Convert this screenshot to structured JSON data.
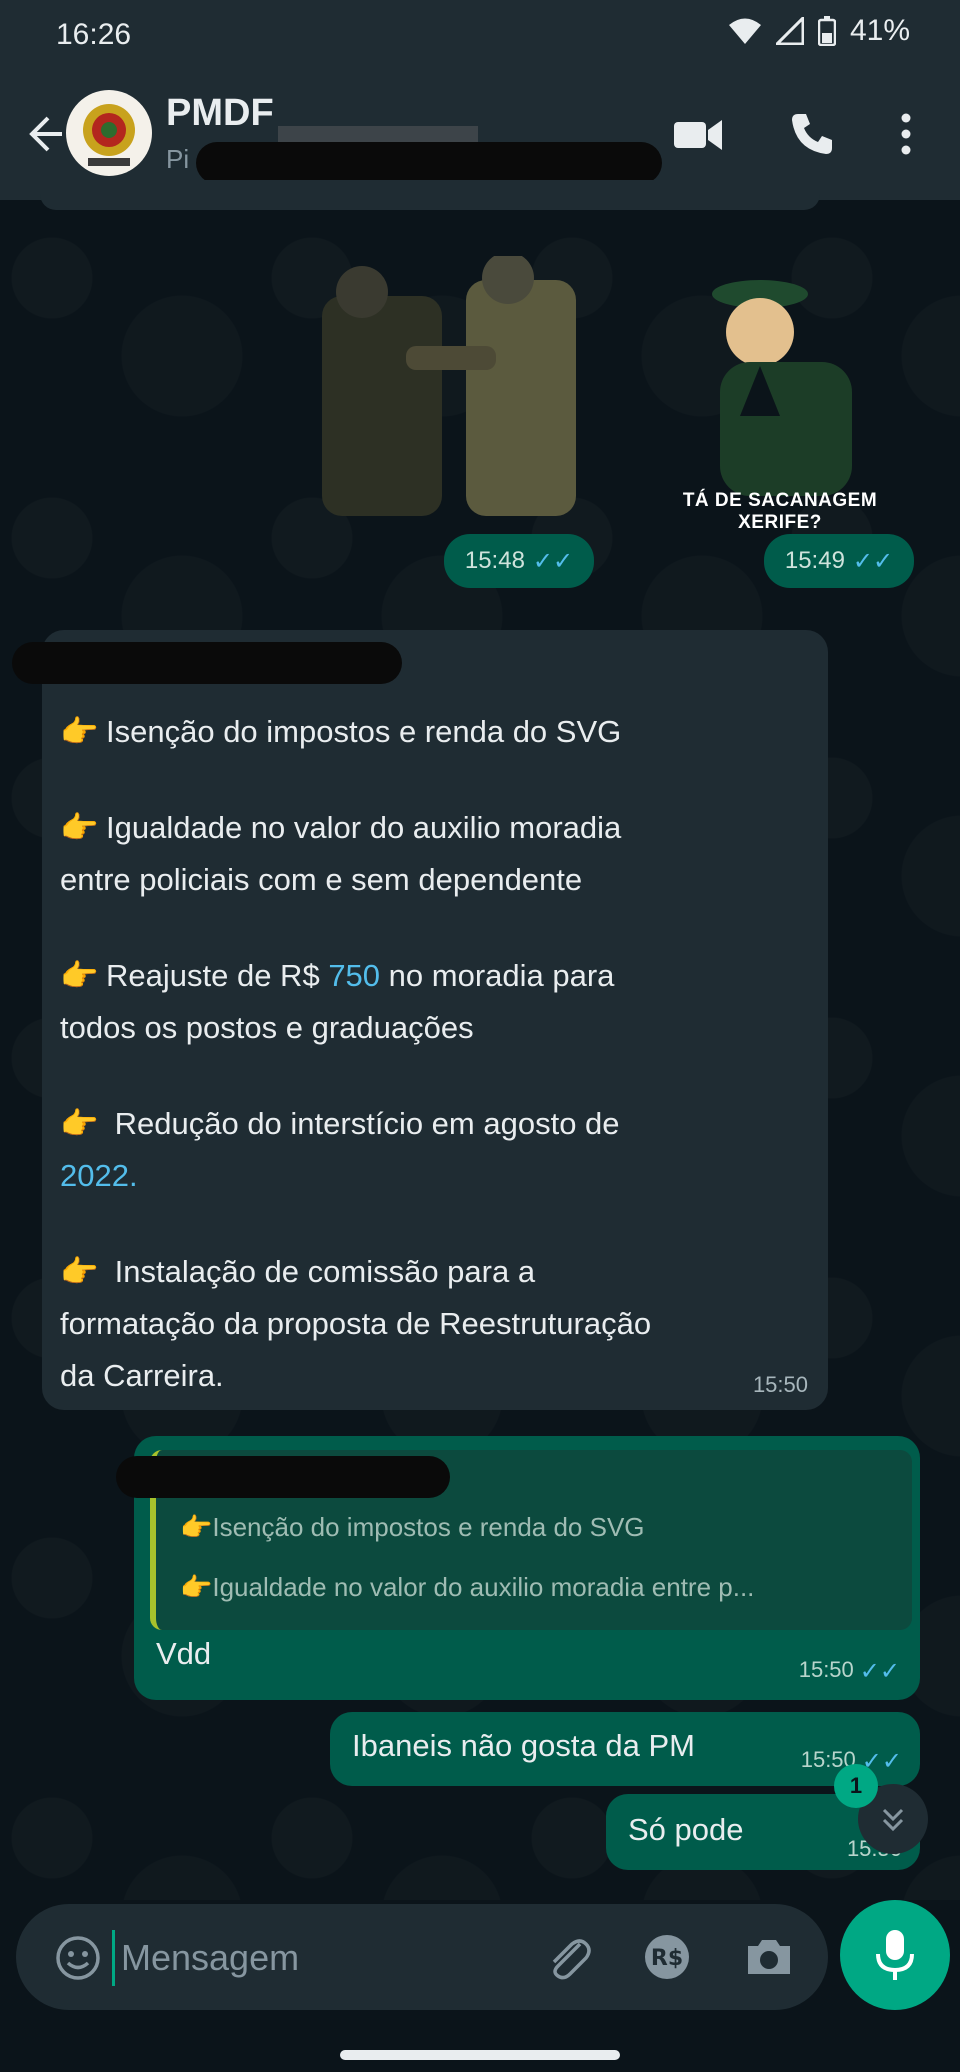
{
  "status_bar": {
    "time": "16:26",
    "battery": "41%"
  },
  "header": {
    "contact_name": "PMDF",
    "contact_sub": "Pi",
    "icons": [
      "back-arrow-icon",
      "video-call-icon",
      "phone-call-icon",
      "more-vert-icon"
    ]
  },
  "stickers": [
    {
      "time": "15:48",
      "caption": ""
    },
    {
      "time": "15:49",
      "caption": "TÁ DE SACANAGEM XERIFE?"
    }
  ],
  "incoming_message": {
    "items": [
      {
        "emoji": "👉",
        "lines": [
          "Isenção do impostos e renda do SVG"
        ]
      },
      {
        "emoji": "👉",
        "lines": [
          "Igualdade no valor do auxilio moradia",
          "entre policiais com e sem dependente"
        ]
      },
      {
        "emoji": "👉",
        "parts": [
          "Reajuste de R$ ",
          "750",
          " no moradia para"
        ],
        "lines": [
          "todos os postos e graduações"
        ]
      },
      {
        "emoji": "👉",
        "lines": [
          " Redução do interstício em agosto de"
        ],
        "link_line": "2022",
        "link_suffix": "."
      },
      {
        "emoji": "👉",
        "lines": [
          " Instalação de comissão para a",
          "formatação da proposta de Reestruturação",
          "da Carreira."
        ]
      }
    ],
    "time": "15:50"
  },
  "reply_message": {
    "quote_lines": [
      "👉Isenção do impostos e renda do SVG",
      "👉Igualdade no valor do auxilio moradia entre p..."
    ],
    "text": "Vdd",
    "time": "15:50"
  },
  "outgoing_messages": [
    {
      "text": "Ibaneis não gosta da PM",
      "time": "15:50"
    },
    {
      "text": "Só pode",
      "time": "15:50"
    }
  ],
  "scroll_badge": "1",
  "input": {
    "placeholder": "Mensagem"
  },
  "colors": {
    "accent": "#00a884",
    "outgoing_bubble": "#005c4b",
    "incoming_bubble": "#1f2c33",
    "read_tick": "#53bdeb",
    "background": "#0b141a"
  }
}
